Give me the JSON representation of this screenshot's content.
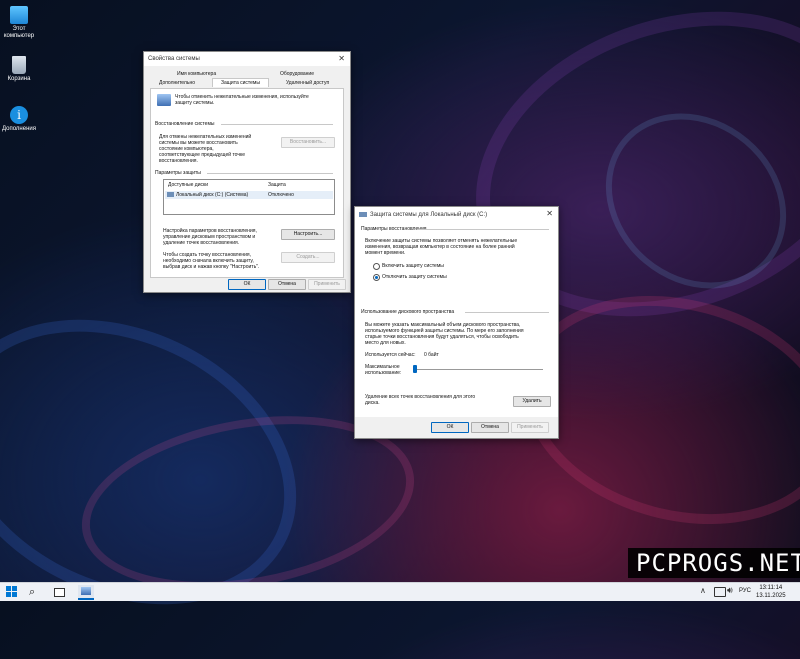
{
  "desktop": {
    "icons": [
      {
        "name": "this-pc",
        "label_line1": "Этот",
        "label_line2": "компьютер"
      },
      {
        "name": "recycle-bin",
        "label_line1": "Корзина",
        "label_line2": ""
      },
      {
        "name": "extras",
        "label_line1": "Дополнения",
        "label_line2": ""
      }
    ]
  },
  "sysprops": {
    "title": "Свойства системы",
    "tabs_row1": [
      "Имя компьютера",
      "Оборудование"
    ],
    "tabs_row2": [
      "Дополнительно",
      "Защита системы",
      "Удаленный доступ"
    ],
    "intro": [
      "Чтобы отменить нежелательные изменения, используйте",
      "защиту системы."
    ],
    "restore_header": "Восстановление системы",
    "restore_text": [
      "Для отмены нежелательных изменений",
      "системы вы можете восстановить",
      "состояние компьютера,",
      "соответствующее предыдущей точке",
      "восстановления."
    ],
    "restore_btn": "Восстановить...",
    "params_header": "Параметры защиты",
    "col_disks": "Доступные диски",
    "col_protect": "Защита",
    "disk_name": "Локальный диск (C:) (Система)",
    "disk_status": "Отключено",
    "config_text": [
      "Настройка параметров восстановления,",
      "управление дисковым пространством и",
      "удаление точек восстановления."
    ],
    "config_btn": "Настроить...",
    "create_text": [
      "Чтобы создать точку восстановления,",
      "необходимо сначала включить защиту,",
      "выбрав диск и нажав кнопку \"Настроить\"."
    ],
    "create_btn": "Создать...",
    "ok": "ОК",
    "cancel": "Отмена",
    "apply": "Применить"
  },
  "protect": {
    "title": "Защита системы для Локальный диск (C:)",
    "restore_params": "Параметры восстановления",
    "desc": [
      "Включение защиты системы позволяет отменять нежелательные",
      "изменения, возвращая компьютер в состояние на более ранний",
      "момент времени."
    ],
    "radio_on": "Включить защиту системы",
    "radio_off": "Отключить защиту системы",
    "selected_radio": "off",
    "disk_space": "Использование дискового пространства",
    "space_desc": [
      "Вы можете указать максимальный объем дискового пространства,",
      "используемого функцией защиты системы. По мере его заполнения",
      "старые точки восстановления будут удаляться, чтобы освободить",
      "место для новых."
    ],
    "used_label": "Используется сейчас:",
    "used_value": "0 байт",
    "max_label_1": "Максимальное",
    "max_label_2": "использование:",
    "slider_fraction": 0,
    "delete_text": [
      "Удаление всех точек восстановления для этого",
      "диска."
    ],
    "delete_btn": "Удалить",
    "ok": "ОК",
    "cancel": "Отмена",
    "apply": "Применить"
  },
  "watermark": "PCPROGS.NET",
  "taskbar": {
    "lang": "РУС",
    "time": "13:11:14",
    "date": "13.11.2025"
  }
}
